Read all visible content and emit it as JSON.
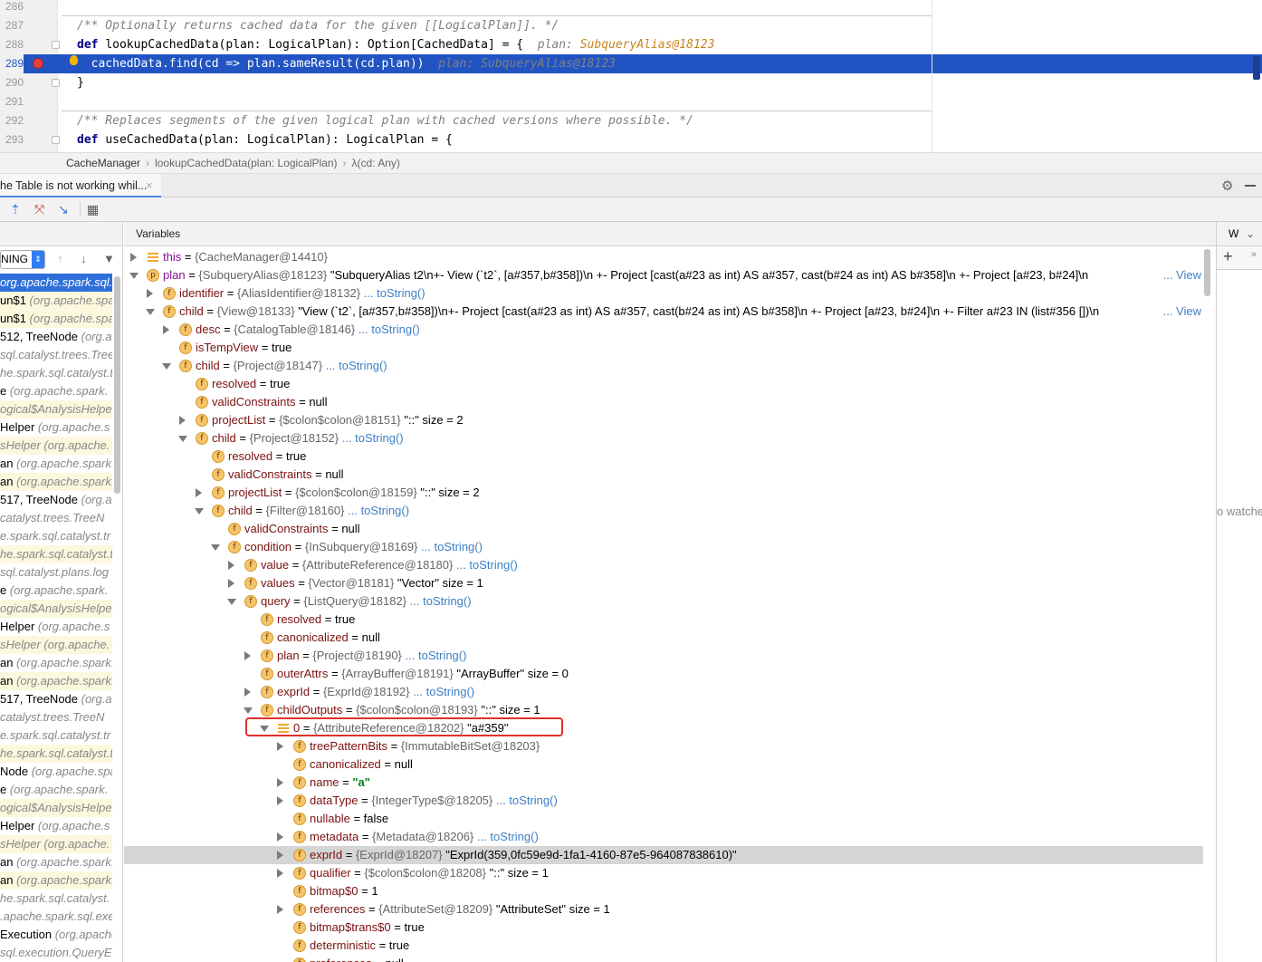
{
  "editor": {
    "lines": [
      {
        "num": "286",
        "segments": []
      },
      {
        "num": "287",
        "segments": [
          {
            "cls": "cmt",
            "t": "/** Optionally returns cached data for the given "
          },
          {
            "cls": "cmt",
            "t": "[[LogicalPlan]]"
          },
          {
            "cls": "cmt",
            "t": ". */"
          }
        ]
      },
      {
        "num": "288",
        "segments": [
          {
            "cls": "kw",
            "t": "def "
          },
          {
            "cls": "",
            "t": "lookupCachedData(plan: LogicalPlan): Option[CachedData] = {  "
          },
          {
            "cls": "hint",
            "t": "plan: "
          },
          {
            "cls": "hintv",
            "t": "SubqueryAlias@18123"
          }
        ]
      },
      {
        "num": "289",
        "segments": [
          {
            "cls": "",
            "t": "  cachedData.find(cd => plan.sameResult(cd.plan))  "
          },
          {
            "cls": "hint",
            "t": "plan: "
          },
          {
            "cls": "hint",
            "t": "SubqueryAlias@18123"
          }
        ]
      },
      {
        "num": "290",
        "segments": [
          {
            "cls": "",
            "t": "}"
          }
        ]
      },
      {
        "num": "291",
        "segments": []
      },
      {
        "num": "292",
        "segments": [
          {
            "cls": "cmt",
            "t": "/** Replaces segments of the given logical plan with cached versions where possible. */"
          }
        ]
      },
      {
        "num": "293",
        "segments": [
          {
            "cls": "kw",
            "t": "def "
          },
          {
            "cls": "",
            "t": "useCachedData(plan: LogicalPlan): LogicalPlan = {"
          }
        ]
      }
    ]
  },
  "breadcrumb": [
    "CacheManager",
    "lookupCachedData(plan: LogicalPlan)",
    "λ(cd: Any)"
  ],
  "debug": {
    "session_tab": "he Table is not working whil...",
    "variables_title": "Variables",
    "watches_title": "W",
    "no_watches": "o watche",
    "thread_selector": "NING"
  },
  "frames": [
    {
      "main": "",
      "pkg": "org.apache.spark.sql.",
      "style": "sel"
    },
    {
      "main": "un$1 ",
      "pkg": "(org.apache.spa",
      "style": "lib"
    },
    {
      "main": "un$1 ",
      "pkg": "(org.apache.spa",
      "style": "lib"
    },
    {
      "main": "512, TreeNode ",
      "pkg": "(org.a",
      "style": ""
    },
    {
      "main": "",
      "pkg": "sql.catalyst.trees.Tree",
      "style": ""
    },
    {
      "main": "",
      "pkg": "he.spark.sql.catalyst.t",
      "style": ""
    },
    {
      "main": "e ",
      "pkg": "(org.apache.spark.",
      "style": ""
    },
    {
      "main": "",
      "pkg": "ogical$AnalysisHelper",
      "style": "lib"
    },
    {
      "main": "Helper ",
      "pkg": "(org.apache.s",
      "style": ""
    },
    {
      "main": "",
      "pkg": "sHelper (org.apache.",
      "style": "lib"
    },
    {
      "main": "an ",
      "pkg": "(org.apache.spark.",
      "style": ""
    },
    {
      "main": "an ",
      "pkg": "(org.apache.spark.",
      "style": "lib"
    },
    {
      "main": "517, TreeNode ",
      "pkg": "(org.a",
      "style": ""
    },
    {
      "main": "",
      "pkg": "catalyst.trees.TreeN",
      "style": ""
    },
    {
      "main": "",
      "pkg": "e.spark.sql.catalyst.tr",
      "style": ""
    },
    {
      "main": "",
      "pkg": "he.spark.sql.catalyst.t",
      "style": "lib"
    },
    {
      "main": "",
      "pkg": "sql.catalyst.plans.log",
      "style": ""
    },
    {
      "main": "e ",
      "pkg": "(org.apache.spark.",
      "style": ""
    },
    {
      "main": "",
      "pkg": "ogical$AnalysisHelper",
      "style": "lib"
    },
    {
      "main": "Helper ",
      "pkg": "(org.apache.s",
      "style": ""
    },
    {
      "main": "",
      "pkg": "sHelper (org.apache.",
      "style": "lib"
    },
    {
      "main": "an ",
      "pkg": "(org.apache.spark.",
      "style": ""
    },
    {
      "main": "an ",
      "pkg": "(org.apache.spark.",
      "style": "lib"
    },
    {
      "main": "517, TreeNode ",
      "pkg": "(org.a",
      "style": ""
    },
    {
      "main": "",
      "pkg": "catalyst.trees.TreeN",
      "style": ""
    },
    {
      "main": "",
      "pkg": "e.spark.sql.catalyst.tr",
      "style": ""
    },
    {
      "main": "",
      "pkg": "he.spark.sql.catalyst.t",
      "style": "lib"
    },
    {
      "main": "Node ",
      "pkg": "(org.apache.spa",
      "style": ""
    },
    {
      "main": "e ",
      "pkg": "(org.apache.spark.",
      "style": ""
    },
    {
      "main": "",
      "pkg": "ogical$AnalysisHelper",
      "style": "lib"
    },
    {
      "main": "Helper ",
      "pkg": "(org.apache.s",
      "style": ""
    },
    {
      "main": "",
      "pkg": "sHelper (org.apache.",
      "style": "lib"
    },
    {
      "main": "an ",
      "pkg": "(org.apache.spark.",
      "style": ""
    },
    {
      "main": "an ",
      "pkg": "(org.apache.spark.",
      "style": "lib"
    },
    {
      "main": "",
      "pkg": "he.spark.sql.catalyst.",
      "style": ""
    },
    {
      "main": "",
      "pkg": ".apache.spark.sql.exe",
      "style": ""
    },
    {
      "main": "Execution ",
      "pkg": "(org.apache",
      "style": ""
    },
    {
      "main": "",
      "pkg": "sql.execution.QueryE",
      "style": ""
    }
  ],
  "variables": [
    {
      "d": 0,
      "tw": "r",
      "icon": "lines",
      "name": "this",
      "type": "{CacheManager@14410}",
      "val": "",
      "link": "",
      "view": ""
    },
    {
      "d": 0,
      "tw": "d",
      "icon": "p",
      "name": "plan",
      "type": "{SubqueryAlias@18123}",
      "val": "\"SubqueryAlias t2\\n+- View (`t2`, [a#357,b#358])\\n   +- Project [cast(a#23 as int) AS a#357, cast(b#24 as int) AS b#358]\\n      +- Project [a#23, b#24]\\n",
      "link": "",
      "view": "... View"
    },
    {
      "d": 1,
      "tw": "r",
      "icon": "f",
      "name": "identifier",
      "type": "{AliasIdentifier@18132}",
      "val": "",
      "link": "... toString()",
      "view": ""
    },
    {
      "d": 1,
      "tw": "d",
      "icon": "f",
      "name": "child",
      "type": "{View@18133}",
      "val": "\"View (`t2`, [a#357,b#358])\\n+- Project [cast(a#23 as int) AS a#357, cast(b#24 as int) AS b#358]\\n   +- Project [a#23, b#24]\\n      +- Filter a#23 IN (list#356 [])\\n",
      "link": "",
      "view": "... View"
    },
    {
      "d": 2,
      "tw": "r",
      "icon": "f",
      "name": "desc",
      "type": "{CatalogTable@18146}",
      "val": "",
      "link": "... toString()",
      "view": ""
    },
    {
      "d": 2,
      "tw": "",
      "icon": "f",
      "name": "isTempView",
      "type": "",
      "val": "true",
      "link": "",
      "view": ""
    },
    {
      "d": 2,
      "tw": "d",
      "icon": "f",
      "name": "child",
      "type": "{Project@18147}",
      "val": "",
      "link": "... toString()",
      "view": ""
    },
    {
      "d": 3,
      "tw": "",
      "icon": "f",
      "name": "resolved",
      "type": "",
      "val": "true",
      "link": "",
      "view": ""
    },
    {
      "d": 3,
      "tw": "",
      "icon": "f",
      "name": "validConstraints",
      "type": "",
      "val": "null",
      "link": "",
      "view": ""
    },
    {
      "d": 3,
      "tw": "r",
      "icon": "f",
      "name": "projectList",
      "type": "{$colon$colon@18151}",
      "val": "\"::\" size = 2",
      "link": "",
      "view": ""
    },
    {
      "d": 3,
      "tw": "d",
      "icon": "f",
      "name": "child",
      "type": "{Project@18152}",
      "val": "",
      "link": "... toString()",
      "view": ""
    },
    {
      "d": 4,
      "tw": "",
      "icon": "f",
      "name": "resolved",
      "type": "",
      "val": "true",
      "link": "",
      "view": ""
    },
    {
      "d": 4,
      "tw": "",
      "icon": "f",
      "name": "validConstraints",
      "type": "",
      "val": "null",
      "link": "",
      "view": ""
    },
    {
      "d": 4,
      "tw": "r",
      "icon": "f",
      "name": "projectList",
      "type": "{$colon$colon@18159}",
      "val": "\"::\" size = 2",
      "link": "",
      "view": ""
    },
    {
      "d": 4,
      "tw": "d",
      "icon": "f",
      "name": "child",
      "type": "{Filter@18160}",
      "val": "",
      "link": "... toString()",
      "view": ""
    },
    {
      "d": 5,
      "tw": "",
      "icon": "f",
      "name": "validConstraints",
      "type": "",
      "val": "null",
      "link": "",
      "view": ""
    },
    {
      "d": 5,
      "tw": "d",
      "icon": "f",
      "name": "condition",
      "type": "{InSubquery@18169}",
      "val": "",
      "link": "... toString()",
      "view": ""
    },
    {
      "d": 6,
      "tw": "r",
      "icon": "f",
      "name": "value",
      "type": "{AttributeReference@18180}",
      "val": "",
      "link": "... toString()",
      "view": ""
    },
    {
      "d": 6,
      "tw": "r",
      "icon": "f",
      "name": "values",
      "type": "{Vector@18181}",
      "val": "\"Vector\" size = 1",
      "link": "",
      "view": ""
    },
    {
      "d": 6,
      "tw": "d",
      "icon": "f",
      "name": "query",
      "type": "{ListQuery@18182}",
      "val": "",
      "link": "... toString()",
      "view": ""
    },
    {
      "d": 7,
      "tw": "",
      "icon": "f",
      "name": "resolved",
      "type": "",
      "val": "true",
      "link": "",
      "view": ""
    },
    {
      "d": 7,
      "tw": "",
      "icon": "f",
      "name": "canonicalized",
      "type": "",
      "val": "null",
      "link": "",
      "view": ""
    },
    {
      "d": 7,
      "tw": "r",
      "icon": "f",
      "name": "plan",
      "type": "{Project@18190}",
      "val": "",
      "link": "... toString()",
      "view": ""
    },
    {
      "d": 7,
      "tw": "",
      "icon": "f",
      "name": "outerAttrs",
      "type": "{ArrayBuffer@18191}",
      "val": "\"ArrayBuffer\" size = 0",
      "link": "",
      "view": ""
    },
    {
      "d": 7,
      "tw": "r",
      "icon": "f",
      "name": "exprId",
      "type": "{ExprId@18192}",
      "val": "",
      "link": "... toString()",
      "view": ""
    },
    {
      "d": 7,
      "tw": "d",
      "icon": "f",
      "name": "childOutputs",
      "type": "{$colon$colon@18193}",
      "val": "\"::\" size = 1",
      "link": "",
      "view": ""
    },
    {
      "d": 8,
      "tw": "d",
      "icon": "lines",
      "name": "0",
      "type": "{AttributeReference@18202}",
      "val": "\"a#359\"",
      "link": "",
      "view": ""
    },
    {
      "d": 9,
      "tw": "r",
      "icon": "f",
      "name": "treePatternBits",
      "type": "{ImmutableBitSet@18203}",
      "val": "",
      "link": "",
      "view": ""
    },
    {
      "d": 9,
      "tw": "",
      "icon": "f",
      "name": "canonicalized",
      "type": "",
      "val": "null",
      "link": "",
      "view": ""
    },
    {
      "d": 9,
      "tw": "r",
      "icon": "f",
      "name": "name",
      "type": "",
      "val": "",
      "str": "\"a\"",
      "link": "",
      "view": ""
    },
    {
      "d": 9,
      "tw": "r",
      "icon": "f",
      "name": "dataType",
      "type": "{IntegerType$@18205}",
      "val": "",
      "link": "... toString()",
      "view": ""
    },
    {
      "d": 9,
      "tw": "",
      "icon": "f",
      "name": "nullable",
      "type": "",
      "val": "false",
      "link": "",
      "view": ""
    },
    {
      "d": 9,
      "tw": "r",
      "icon": "f",
      "name": "metadata",
      "type": "{Metadata@18206}",
      "val": "",
      "link": "... toString()",
      "view": ""
    },
    {
      "d": 9,
      "tw": "r",
      "icon": "f",
      "name": "exprId",
      "type": "{ExprId@18207}",
      "val": "\"ExprId(359,0fc59e9d-1fa1-4160-87e5-964087838610)\"",
      "link": "",
      "view": "",
      "hl": true
    },
    {
      "d": 9,
      "tw": "r",
      "icon": "f",
      "name": "qualifier",
      "type": "{$colon$colon@18208}",
      "val": "\"::\" size = 1",
      "link": "",
      "view": ""
    },
    {
      "d": 9,
      "tw": "",
      "icon": "f",
      "name": "bitmap$0",
      "type": "",
      "val": "1",
      "link": "",
      "view": ""
    },
    {
      "d": 9,
      "tw": "r",
      "icon": "f",
      "name": "references",
      "type": "{AttributeSet@18209}",
      "val": "\"AttributeSet\" size = 1",
      "link": "",
      "view": ""
    },
    {
      "d": 9,
      "tw": "",
      "icon": "f",
      "name": "bitmap$trans$0",
      "type": "",
      "val": "true",
      "link": "",
      "view": ""
    },
    {
      "d": 9,
      "tw": "",
      "icon": "f",
      "name": "deterministic",
      "type": "",
      "val": "true",
      "link": "",
      "view": ""
    },
    {
      "d": 9,
      "tw": "",
      "icon": "f",
      "name": "preferences",
      "type": "",
      "val": "null",
      "link": "",
      "view": ""
    }
  ]
}
